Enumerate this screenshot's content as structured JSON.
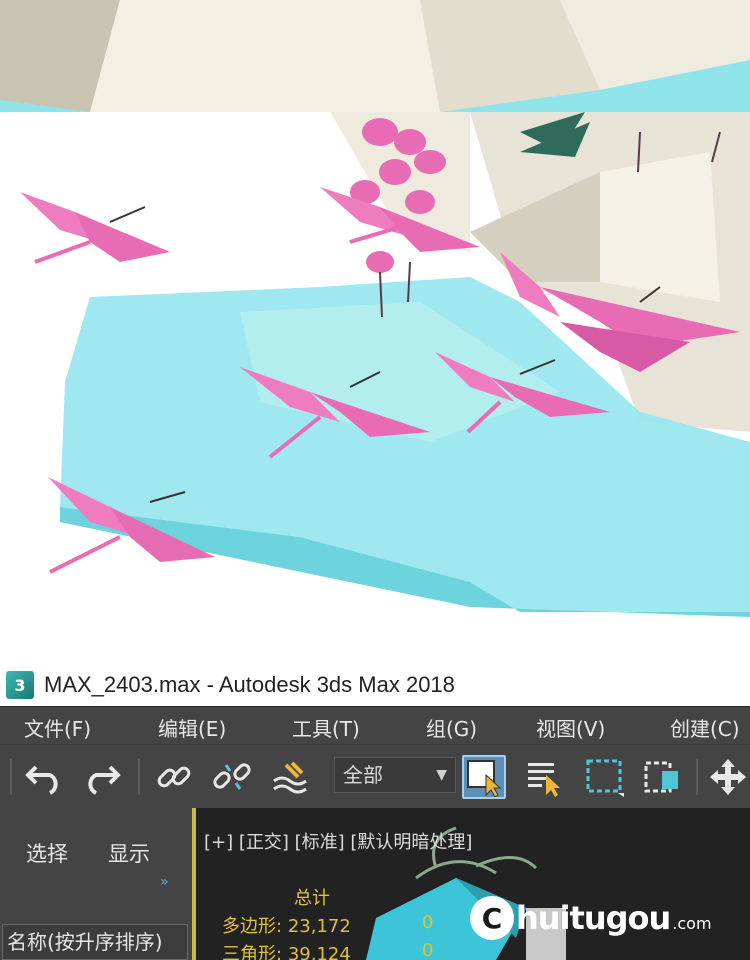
{
  "window": {
    "icon_text": "3",
    "title": "MAX_2403.max - Autodesk 3ds Max 2018"
  },
  "menu": {
    "items": [
      "文件(F)",
      "编辑(E)",
      "工具(T)",
      "组(G)",
      "视图(V)",
      "创建(C)"
    ]
  },
  "toolbar": {
    "selection_filter": "全部",
    "icons": [
      "undo-icon",
      "redo-icon",
      "link-icon",
      "unlink-icon",
      "bind-space-warp-icon",
      "select-object-icon",
      "select-by-name-icon",
      "rectangular-selection-icon",
      "window-crossing-icon",
      "move-icon"
    ]
  },
  "scene_explorer": {
    "tab_select": "选择",
    "tab_display": "显示",
    "expand": "»",
    "column_header": "名称(按升序排序)"
  },
  "viewport": {
    "label": "[+] [正交] [标准] [默认明暗处理]",
    "stats": {
      "header": "总计",
      "polygons_label": "多边形:",
      "polygons_value": "23,172",
      "polygons_sel": "0",
      "triangles_label": "三角形:",
      "triangles_value": "39,124",
      "triangles_sel": "0"
    }
  },
  "watermark": {
    "brand": "huitugou",
    "suffix": ".com",
    "logo_letter": "C"
  },
  "colors": {
    "ui_dark": "#444444",
    "viewport_bg": "#222222",
    "stats_yellow": "#e0c040",
    "water": "#7fe0ea",
    "flamingo": "#e86cb4"
  }
}
